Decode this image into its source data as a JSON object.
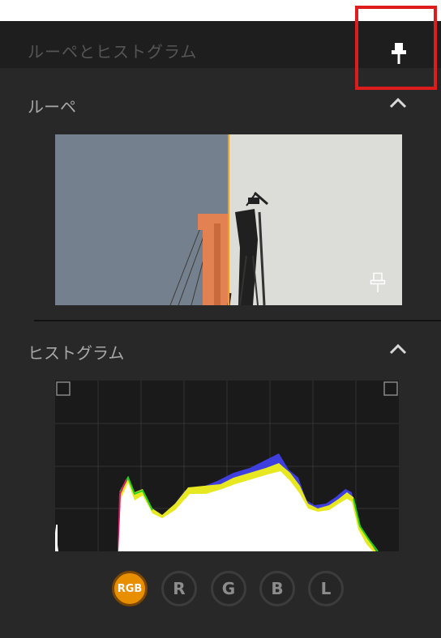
{
  "panel": {
    "title": "ルーペとヒストグラム",
    "pin_icon": "pushpin-icon"
  },
  "loupe": {
    "title": "ルーペ",
    "collapse_icon": "chevron-up-icon",
    "pin_icon": "pushpin-outline-icon"
  },
  "histogram": {
    "title": "ヒストグラム",
    "collapse_icon": "chevron-up-icon",
    "channels": [
      {
        "label": "RGB",
        "active": true
      },
      {
        "label": "R",
        "active": false
      },
      {
        "label": "G",
        "active": false
      },
      {
        "label": "B",
        "active": false
      },
      {
        "label": "L",
        "active": false
      }
    ]
  },
  "colors": {
    "accent": "#e88f00",
    "highlight": "#dd1c1c",
    "panel_bg": "#282828"
  }
}
